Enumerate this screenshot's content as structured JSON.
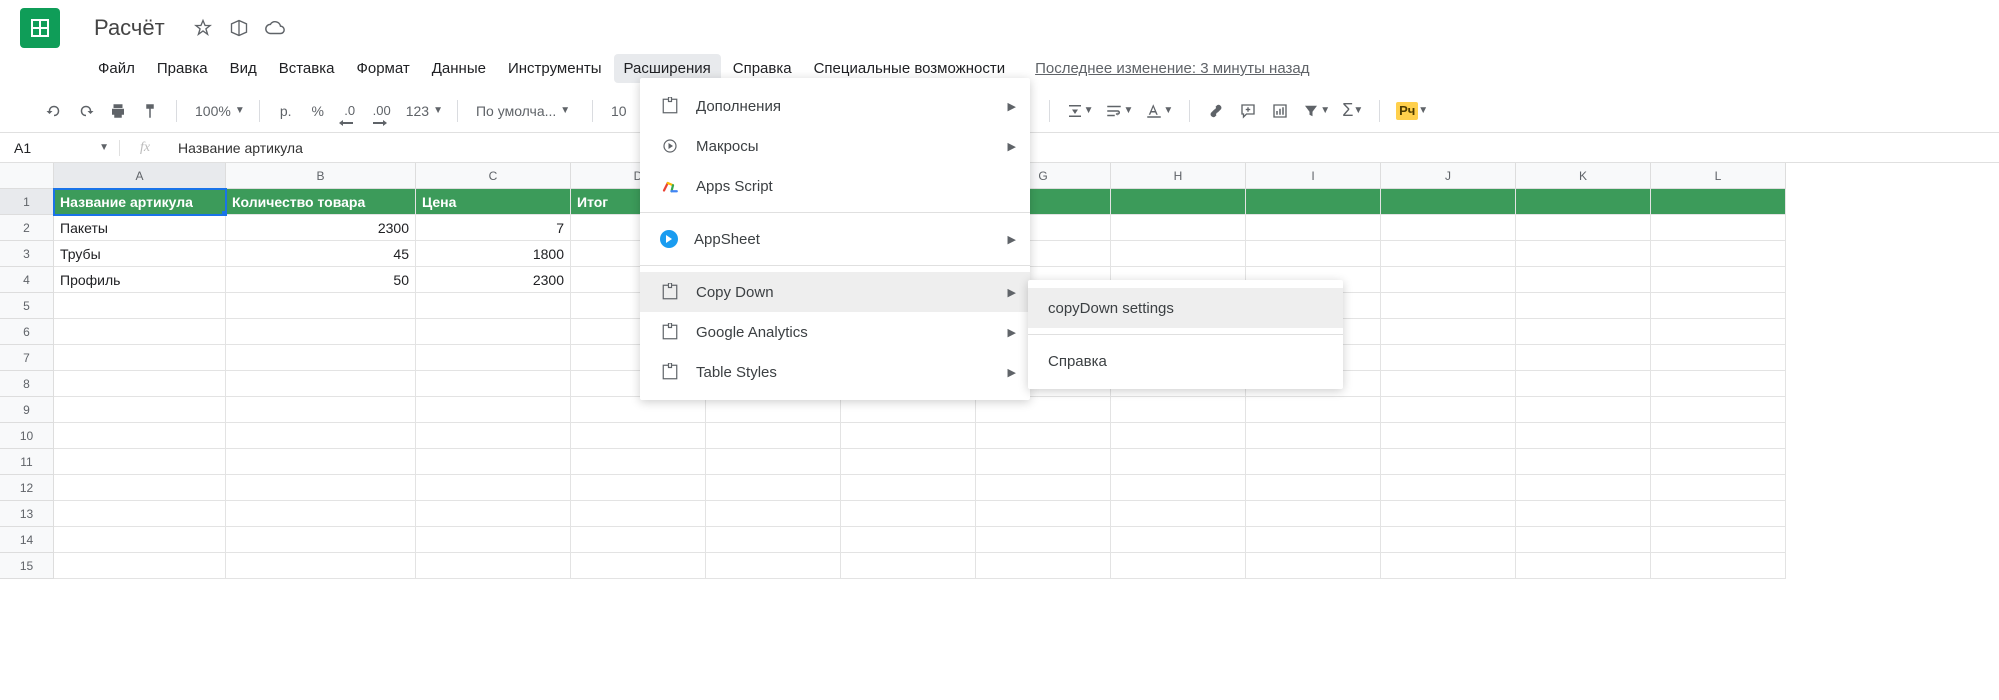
{
  "doc_title": "Расчёт",
  "menu": {
    "file": "Файл",
    "edit": "Правка",
    "view": "Вид",
    "insert": "Вставка",
    "format": "Формат",
    "data": "Данные",
    "tools": "Инструменты",
    "extensions": "Расширения",
    "help": "Справка",
    "accessibility": "Специальные возможности"
  },
  "last_edit": "Последнее изменение: 3 минуты назад",
  "toolbar": {
    "zoom": "100%",
    "currency": "р.",
    "percent": "%",
    "dec_dec": ".0",
    "inc_dec": ".00",
    "num_fmt": "123",
    "font": "По умолча...",
    "font_size": "10",
    "parking": "Pч"
  },
  "namebox": "A1",
  "fx_value": "Название артикула",
  "headers": {
    "A": "Название артикула",
    "B": "Количество товара",
    "C": "Цена",
    "D": "Итог"
  },
  "rows": [
    {
      "A": "Пакеты",
      "B": "2300",
      "C": "7"
    },
    {
      "A": "Трубы",
      "B": "45",
      "C": "1800"
    },
    {
      "A": "Профиль",
      "B": "50",
      "C": "2300"
    }
  ],
  "ext_menu": {
    "addons": "Дополнения",
    "macros": "Макросы",
    "apps_script": "Apps Script",
    "appsheet": "AppSheet",
    "copy_down": "Copy Down",
    "google_analytics": "Google Analytics",
    "table_styles": "Table Styles"
  },
  "sub_menu": {
    "settings": "copyDown settings",
    "help": "Справка"
  }
}
